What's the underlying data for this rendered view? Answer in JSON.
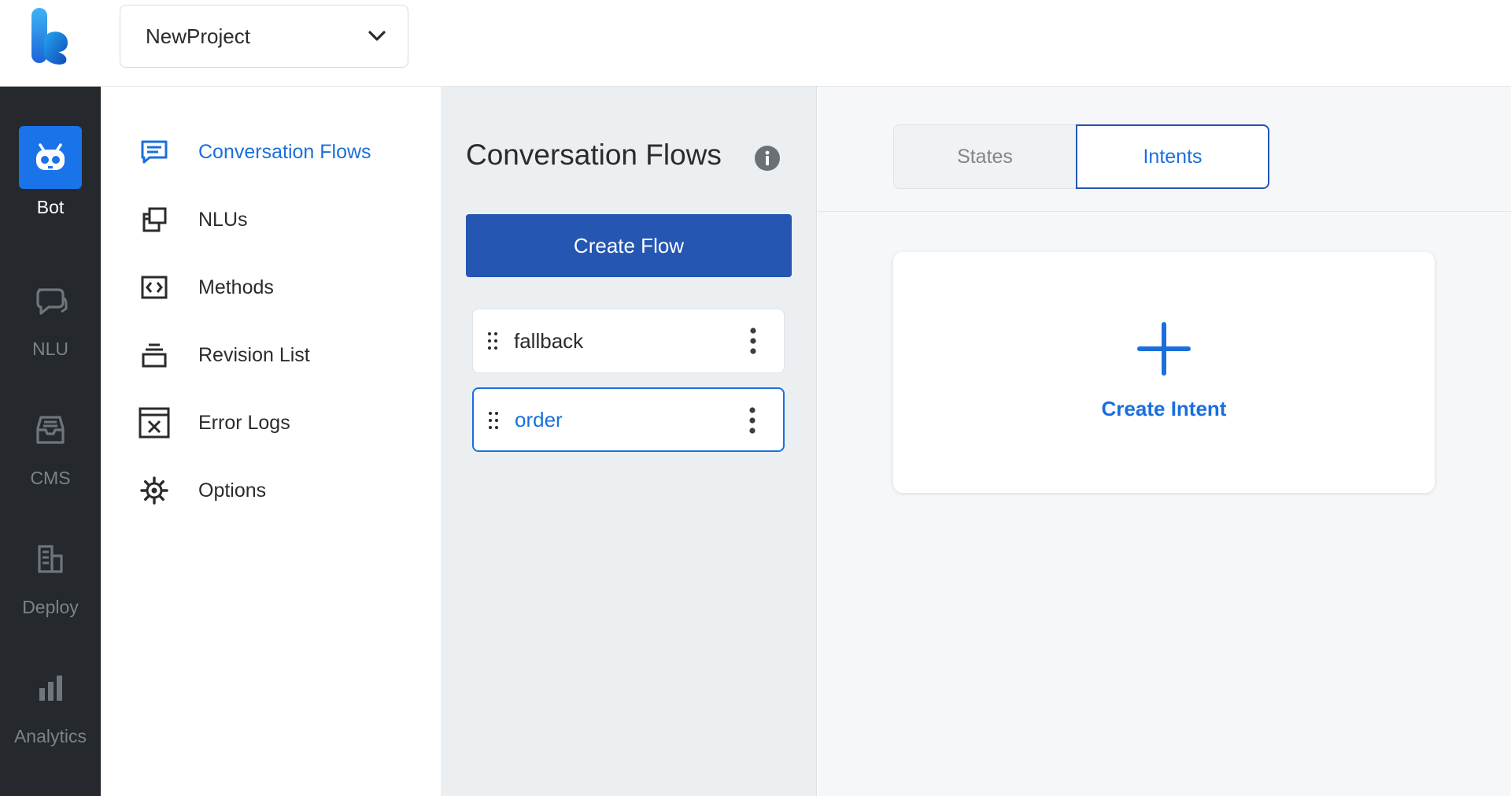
{
  "header": {
    "project_name": "NewProject"
  },
  "rail": {
    "items": [
      {
        "label": "Bot",
        "icon": "robot-icon",
        "active": true
      },
      {
        "label": "NLU",
        "icon": "chat-bubbles-icon"
      },
      {
        "label": "CMS",
        "icon": "inbox-icon"
      },
      {
        "label": "Deploy",
        "icon": "building-icon"
      },
      {
        "label": "Analytics",
        "icon": "bar-chart-icon"
      }
    ]
  },
  "subnav": {
    "items": [
      {
        "label": "Conversation Flows",
        "icon": "message-square-icon",
        "active": true
      },
      {
        "label": "NLUs",
        "icon": "stacked-windows-icon"
      },
      {
        "label": "Methods",
        "icon": "code-brackets-icon"
      },
      {
        "label": "Revision List",
        "icon": "layers-icon"
      },
      {
        "label": "Error Logs",
        "icon": "error-window-icon"
      },
      {
        "label": "Options",
        "icon": "gear-icon"
      }
    ]
  },
  "flows": {
    "title": "Conversation Flows",
    "create_label": "Create Flow",
    "items": [
      {
        "name": "fallback",
        "selected": false
      },
      {
        "name": "order",
        "selected": true
      }
    ]
  },
  "detail": {
    "tabs": [
      {
        "label": "States",
        "active": false
      },
      {
        "label": "Intents",
        "active": true
      }
    ],
    "create_intent_label": "Create Intent"
  },
  "colors": {
    "accent": "#1a6fdc",
    "primary_button": "#2456b2",
    "rail_bg": "#25282c",
    "rail_active": "#1a73e8"
  }
}
